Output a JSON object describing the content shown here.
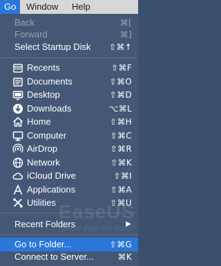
{
  "menubar": {
    "go": "Go",
    "window": "Window",
    "help": "Help"
  },
  "menu": {
    "back": {
      "label": "Back",
      "shortcut": "⌘["
    },
    "forward": {
      "label": "Forward",
      "shortcut": "⌘]"
    },
    "startup": {
      "label": "Select Startup Disk",
      "shortcut": "⇧⌘↑"
    },
    "places": [
      {
        "label": "Recents",
        "shortcut": "⇧⌘F",
        "icon": "recents-icon"
      },
      {
        "label": "Documents",
        "shortcut": "⇧⌘O",
        "icon": "documents-icon"
      },
      {
        "label": "Desktop",
        "shortcut": "⇧⌘D",
        "icon": "desktop-icon"
      },
      {
        "label": "Downloads",
        "shortcut": "⌥⌘L",
        "icon": "downloads-icon"
      },
      {
        "label": "Home",
        "shortcut": "⇧⌘H",
        "icon": "home-icon"
      },
      {
        "label": "Computer",
        "shortcut": "⇧⌘C",
        "icon": "computer-icon"
      },
      {
        "label": "AirDrop",
        "shortcut": "⇧⌘R",
        "icon": "airdrop-icon"
      },
      {
        "label": "Network",
        "shortcut": "⇧⌘K",
        "icon": "network-icon"
      },
      {
        "label": "iCloud Drive",
        "shortcut": "⇧⌘I",
        "icon": "icloud-icon"
      },
      {
        "label": "Applications",
        "shortcut": "⇧⌘A",
        "icon": "applications-icon"
      },
      {
        "label": "Utilities",
        "shortcut": "⇧⌘U",
        "icon": "utilities-icon"
      }
    ],
    "recent_folders": {
      "label": "Recent Folders",
      "submenu": "▶"
    },
    "go_to_folder": {
      "label": "Go to Folder...",
      "shortcut": "⇧⌘G"
    },
    "connect": {
      "label": "Connect to Server...",
      "shortcut": "⌘K"
    }
  },
  "watermark": {
    "brand": "EaseUS",
    "tagline": "Make your life easy!"
  }
}
